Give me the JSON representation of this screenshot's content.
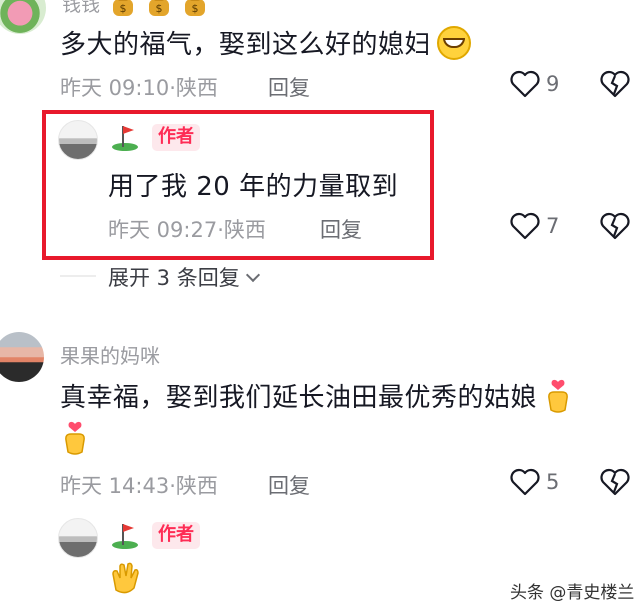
{
  "comments": [
    {
      "username": "钱钱",
      "body": "多大的福气，娶到这么好的媳妇",
      "time": "昨天 09:10",
      "sep": "·",
      "location": "陕西",
      "reply_label": "回复",
      "likes": "9"
    },
    {
      "is_author": true,
      "author_badge": "作者",
      "body": "用了我 20 年的力量取到",
      "time": "昨天 09:27",
      "sep": "·",
      "location": "陕西",
      "reply_label": "回复",
      "likes": "7",
      "expand_label": "展开 3 条回复"
    },
    {
      "username": "果果的妈咪",
      "body": "真幸福，娶到我们延长油田最优秀的姑娘",
      "time": "昨天 14:43",
      "sep": "·",
      "location": "陕西",
      "reply_label": "回复",
      "likes": "5"
    },
    {
      "is_author": true,
      "author_badge": "作者"
    }
  ],
  "watermark": "头条 @青史楼兰",
  "colors": {
    "highlight": "#e8192c",
    "author_badge": "#fe2c55"
  }
}
